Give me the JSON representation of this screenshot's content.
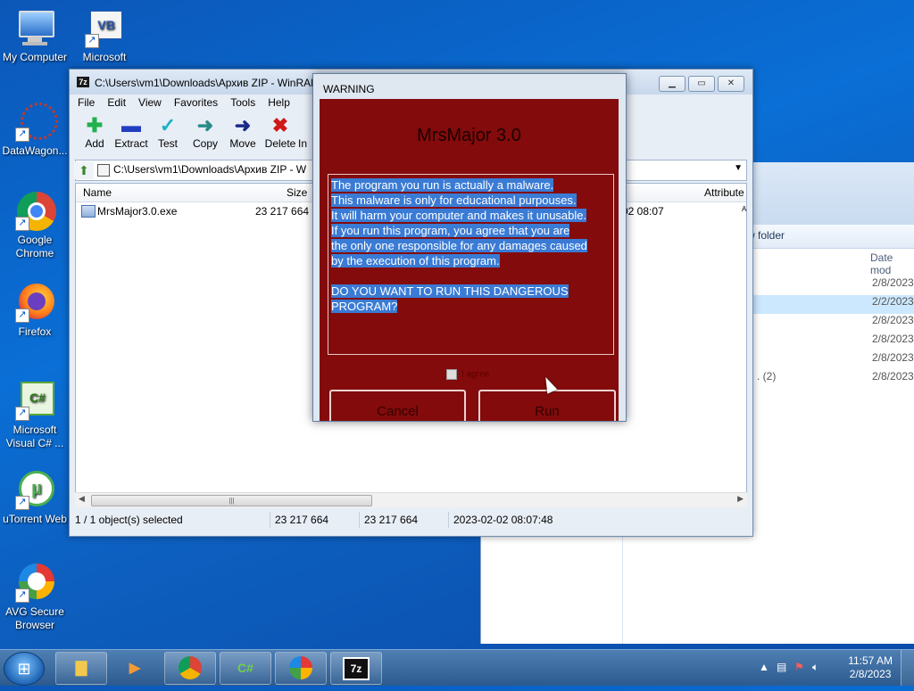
{
  "desktop": {
    "icons": [
      {
        "label": "My Computer",
        "icon": "computer-icon"
      },
      {
        "label": "Microsoft",
        "icon": "visual-basic-icon"
      },
      {
        "label": "DataWagon...",
        "icon": "datawagon-icon"
      },
      {
        "label": "Google Chrome",
        "icon": "chrome-icon"
      },
      {
        "label": "Firefox",
        "icon": "firefox-icon"
      },
      {
        "label": "Microsoft Visual C# ...",
        "icon": "visual-csharp-icon"
      },
      {
        "label": "uTorrent Web",
        "icon": "utorrent-icon"
      },
      {
        "label": "AVG Secure Browser",
        "icon": "avg-browser-icon"
      }
    ]
  },
  "explorer": {
    "new_folder": "w folder",
    "col_date": "Date mod",
    "rows": [
      {
        "name": "",
        "date": "2/8/2023"
      },
      {
        "name": "",
        "date": "2/2/2023"
      },
      {
        "name": "",
        "date": "2/8/2023"
      },
      {
        "name": "",
        "date": "2/8/2023"
      },
      {
        "name": "",
        "date": "2/8/2023"
      },
      {
        "name": ". (2)",
        "date": "2/8/2023"
      }
    ]
  },
  "winrar": {
    "title": "C:\\Users\\vm1\\Downloads\\Архив ZIP - WinRAR",
    "menu": [
      "File",
      "Edit",
      "View",
      "Favorites",
      "Tools",
      "Help"
    ],
    "toolbar": [
      {
        "label": "Add",
        "icon": "add-icon",
        "color": "#22b14c",
        "glyph": "✚"
      },
      {
        "label": "Extract",
        "icon": "extract-icon",
        "color": "#1f3fbf",
        "glyph": "▬"
      },
      {
        "label": "Test",
        "icon": "test-icon",
        "color": "#19b3c4",
        "glyph": "✓"
      },
      {
        "label": "Copy",
        "icon": "copy-icon",
        "color": "#2a8a8a",
        "glyph": "➜"
      },
      {
        "label": "Move",
        "icon": "move-icon",
        "color": "#1a2a8a",
        "glyph": "➜"
      },
      {
        "label": "Delete",
        "icon": "delete-icon",
        "color": "#d01818",
        "glyph": "✖"
      },
      {
        "label": "In",
        "icon": "info-icon",
        "color": "#444444",
        "glyph": ""
      }
    ],
    "address": "C:\\Users\\vm1\\Downloads\\Архив ZIP - W",
    "columns": {
      "name": "Name",
      "size": "Size",
      "attributes": "Attribute"
    },
    "files": [
      {
        "name": "MrsMajor3.0.exe",
        "size": "23 217 664",
        "modified": "02 08:07",
        "attr": "A"
      }
    ],
    "status": {
      "selected": "1 / 1 object(s) selected",
      "size": "23 217 664",
      "packed": "23 217 664",
      "date": "2023-02-02 08:07:48"
    }
  },
  "warning": {
    "title": "WARNING",
    "heading": "MrsMajor 3.0",
    "lines": [
      "The program you run is actually a malware.",
      "This malware is only for educational purpouses.",
      "It will harm your computer and makes it unusable.",
      "If you run this program, you agree that you are",
      "the only one responsible for any damages caused",
      "by the execution of this program.",
      "",
      "DO YOU WANT TO RUN THIS DANGEROUS",
      "PROGRAM?"
    ],
    "agree_label": "I agree",
    "cancel": "Cancel",
    "run": "Run"
  },
  "taskbar": {
    "items": [
      "explorer-icon",
      "media-player-icon",
      "chrome-icon",
      "visual-csharp-icon",
      "avg-browser-icon",
      "7zip-icon"
    ],
    "time": "11:57 AM",
    "date": "2/8/2023"
  }
}
